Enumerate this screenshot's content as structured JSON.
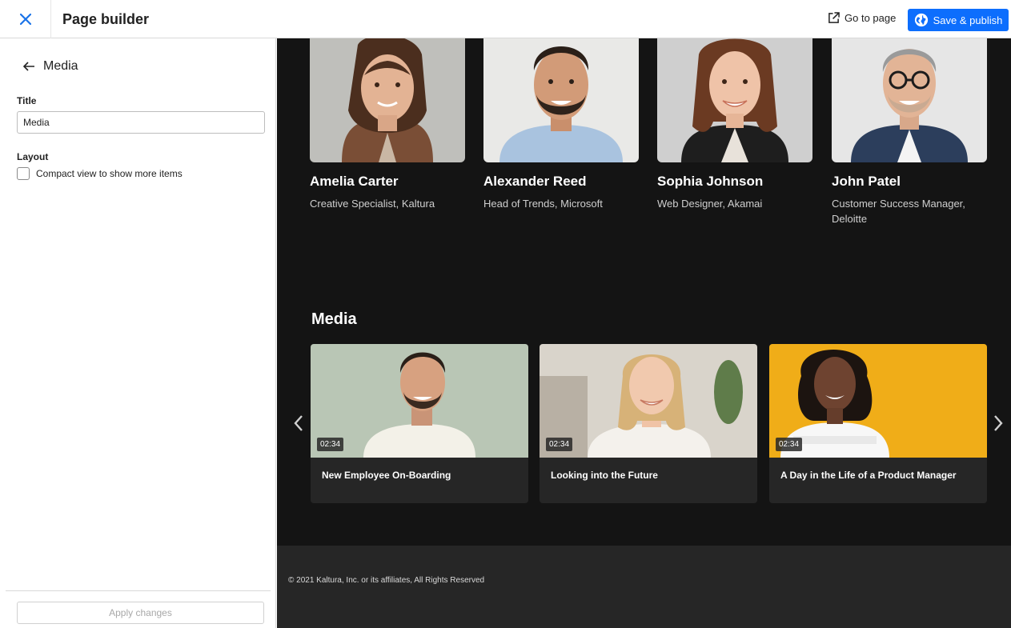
{
  "header": {
    "title": "Page builder",
    "go_to_page_label": "Go to page",
    "save_publish_label": "Save & publish",
    "accent_color": "#0d6efd"
  },
  "sidebar": {
    "back_label": "Media",
    "title_label": "Title",
    "title_value": "Media",
    "layout_label": "Layout",
    "compact_view_label": "Compact view to show more items",
    "compact_view_checked": false,
    "apply_label": "Apply changes"
  },
  "speakers": [
    {
      "name": "Amelia Carter",
      "role": "Creative Specialist, Kaltura"
    },
    {
      "name": "Alexander Reed",
      "role": "Head of Trends, Microsoft"
    },
    {
      "name": "Sophia Johnson",
      "role": "Web Designer, Akamai"
    },
    {
      "name": "John Patel",
      "role": "Customer Success Manager, Deloitte"
    }
  ],
  "media": {
    "heading": "Media",
    "items": [
      {
        "title": "New Employee On-Boarding",
        "duration": "02:34"
      },
      {
        "title": "Looking into the Future",
        "duration": "02:34"
      },
      {
        "title": "A Day in the Life of a Product Manager",
        "duration": "02:34"
      }
    ]
  },
  "footer": {
    "copyright": "© 2021 Kaltura, Inc. or its affiliates, All Rights Reserved"
  }
}
